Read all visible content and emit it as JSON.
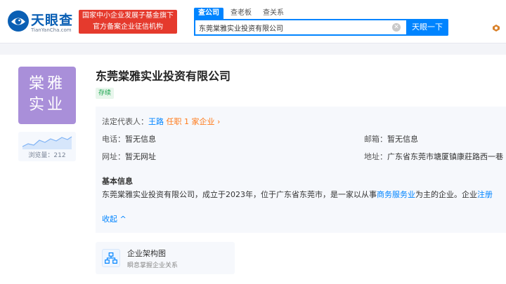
{
  "header": {
    "logo_name": "天眼查",
    "logo_domain": "TianYanCha.com",
    "slogan_line1": "国家中小企业发展子基金旗下",
    "slogan_line2": "官方备案企业征信机构",
    "search_tabs": [
      "查公司",
      "查老板",
      "查关系"
    ],
    "search_value": "东莞棠雅实业投资有限公司",
    "search_button": "天眼一下",
    "accent_color": "#0084ff",
    "slogan_color": "#e53a2d"
  },
  "company": {
    "logo_line1": "棠雅",
    "logo_line2": "实业",
    "logo_color": "#a98fd9",
    "name": "东莞棠雅实业投资有限公司",
    "status": "存续",
    "views_label": "浏览量：212",
    "legal_rep_label": "法定代表人：",
    "legal_rep_name": "王路",
    "legal_rep_role": "任职 1 家企业 ›",
    "phone_label": "电话：",
    "phone_value": "暂无信息",
    "email_label": "邮箱：",
    "email_value": "暂无信息",
    "website_label": "网址：",
    "website_value": "暂无网址",
    "address_label": "地址：",
    "address_value": "广东省东莞市塘厦镇康莊路西一巷",
    "basic_title": "基本信息",
    "basic_text_part1": "东莞棠雅实业投资有限公司，成立于2023年，位于广东省东莞市，是一家以从事",
    "basic_text_link": "商务服务业",
    "basic_text_part2": "为主的企业。企业",
    "basic_text_link2": "注册",
    "collapse_label": "收起 ^"
  },
  "structure": {
    "title": "企业架构图",
    "subtitle": "瞬息掌握企业关系"
  }
}
